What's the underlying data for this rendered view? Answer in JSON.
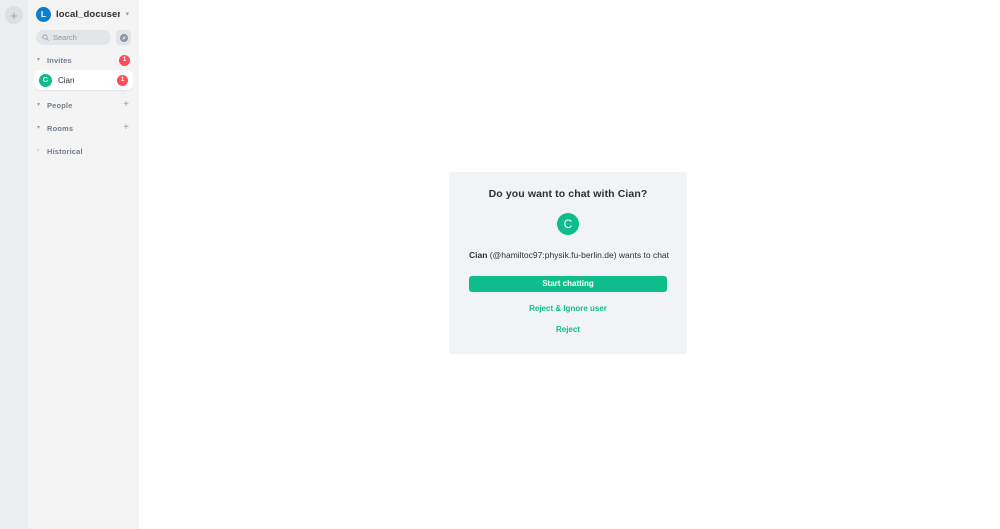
{
  "colors": {
    "brand_green": "#0dbd8b",
    "avatar_blue": "#0b7ed0",
    "badge_red": "#ff4b55",
    "sidebar_bg": "#f4f4f5",
    "strip_bg": "#ebedef",
    "card_bg": "#f1f4f7",
    "text_primary": "#2e2f32",
    "text_muted": "#737d8c"
  },
  "space_panel": {
    "add_space_label": "+"
  },
  "sidebar": {
    "user": {
      "avatar_letter": "L",
      "name": "local_docuser",
      "menu_chevron": "▾"
    },
    "search": {
      "placeholder": "Search",
      "value": "",
      "icon": "search-icon"
    },
    "explore_button": {
      "icon": "explore-compass-icon"
    },
    "sections": [
      {
        "id": "invites",
        "label": "Invites",
        "expanded": true,
        "chevron": "▾",
        "badge": "1",
        "add_label": null
      },
      {
        "id": "people",
        "label": "People",
        "expanded": true,
        "chevron": "▾",
        "badge": null,
        "add_label": "+"
      },
      {
        "id": "rooms",
        "label": "Rooms",
        "expanded": true,
        "chevron": "▾",
        "badge": null,
        "add_label": "+"
      },
      {
        "id": "historical",
        "label": "Historical",
        "expanded": false,
        "chevron": "›",
        "badge": null,
        "add_label": null
      }
    ],
    "invite_items": [
      {
        "avatar_letter": "C",
        "name": "Cian",
        "badge": "1"
      }
    ]
  },
  "invite_card": {
    "title": "Do you want to chat with Cian?",
    "avatar_letter": "C",
    "display_name": "Cian",
    "user_id": "(@hamiltoc97:physik.fu-berlin.de)",
    "subtitle_tail": "wants to chat",
    "start_button": "Start chatting",
    "reject_ignore_link": "Reject & Ignore user",
    "reject_link": "Reject"
  }
}
